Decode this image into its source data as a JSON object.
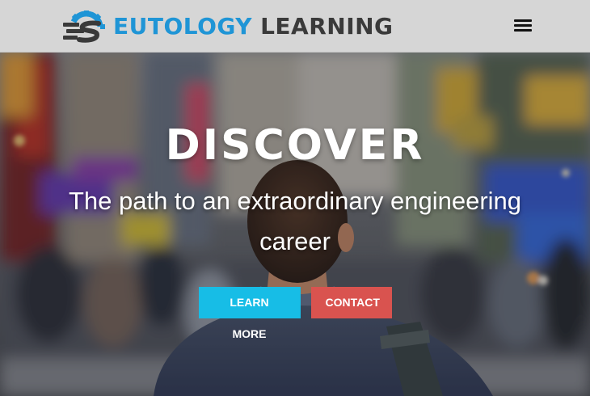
{
  "navbar": {
    "brand_word_1": "EUTOLOGY",
    "brand_word_2": "LEARNING",
    "logo_icon": "gear-s-logo-icon",
    "menu_icon": "hamburger-menu-icon"
  },
  "hero": {
    "title": "DISCOVER",
    "subtitle": "The path to an extraordinary engineering career",
    "buttons": {
      "learn_more": "LEARN MORE",
      "contact": "CONTACT"
    }
  },
  "colors": {
    "navbar_bg": "#d6d6d6",
    "brand_blue": "#1f95d6",
    "brand_dark": "#3a3a3a",
    "learn_more_bg": "#17bde6",
    "contact_bg": "#d9534f"
  }
}
